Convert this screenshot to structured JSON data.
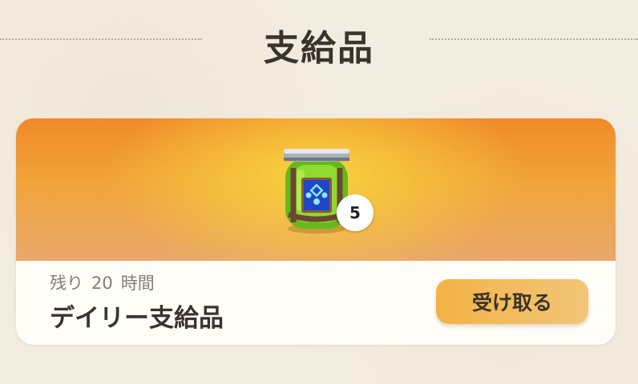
{
  "header": {
    "title": "支給品"
  },
  "supply": {
    "remaining_label": "残り",
    "remaining_value": "20",
    "remaining_unit": "時間",
    "name": "デイリー支給品",
    "claim_label": "受け取る",
    "item": {
      "icon": "green-potion-jar-icon",
      "count": "5"
    }
  },
  "colors": {
    "background": "#f3ece0",
    "banner_top": "#f08a2a",
    "banner_center": "#f9d33e",
    "button": "#f2b343",
    "text_dark": "#3b332d",
    "text_muted": "#857c72"
  }
}
